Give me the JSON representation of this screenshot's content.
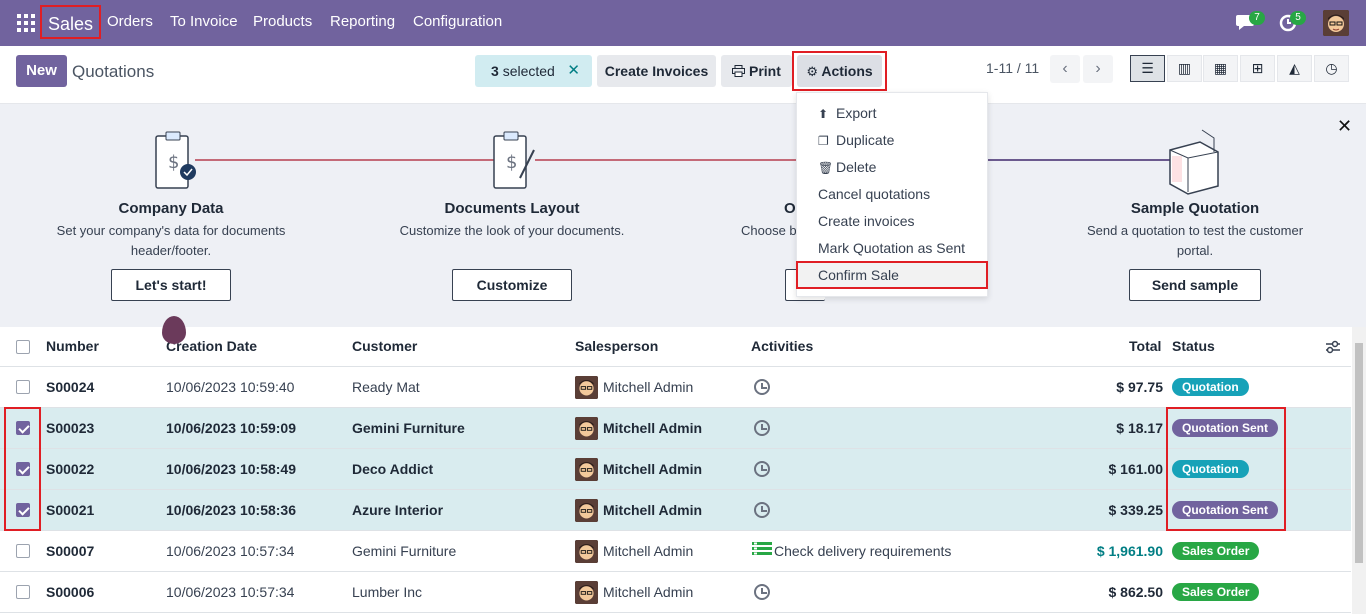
{
  "nav": {
    "brand": "Sales",
    "menu": [
      "Orders",
      "To Invoice",
      "Products",
      "Reporting",
      "Configuration"
    ],
    "messages_count": "7",
    "activities_count": "5"
  },
  "control_panel": {
    "new_label": "New",
    "title": "Quotations",
    "selected_count": "3",
    "selected_label": "selected",
    "create_invoices_label": "Create Invoices",
    "print_label": "Print",
    "actions_label": "Actions",
    "pager": "1-11 / 11"
  },
  "actions_menu": [
    {
      "label": "Export",
      "icon": "upload-icon"
    },
    {
      "label": "Duplicate",
      "icon": "copy-icon"
    },
    {
      "label": "Delete",
      "icon": "trash-icon"
    },
    {
      "label": "Cancel quotations",
      "icon": ""
    },
    {
      "label": "Create invoices",
      "icon": ""
    },
    {
      "label": "Mark Quotation as Sent",
      "icon": ""
    },
    {
      "label": "Confirm Sale",
      "icon": ""
    }
  ],
  "onboarding": {
    "steps": [
      {
        "title": "Company Data",
        "desc1": "Set your company's data for documents",
        "desc2": "header/footer.",
        "button": "Let's start!"
      },
      {
        "title": "Documents Layout",
        "desc1": "Customize the look of your documents.",
        "desc2": "",
        "button": "Customize"
      },
      {
        "title": "O",
        "desc1": "Choose b",
        "desc2": "",
        "button": ""
      },
      {
        "title": "Sample Quotation",
        "desc1": "Send a quotation to test the customer",
        "desc2": "portal.",
        "button": "Send sample"
      }
    ]
  },
  "table": {
    "headers": {
      "number": "Number",
      "creation_date": "Creation Date",
      "customer": "Customer",
      "salesperson": "Salesperson",
      "activities": "Activities",
      "total": "Total",
      "status": "Status"
    },
    "rows": [
      {
        "number": "S00024",
        "date": "10/06/2023 10:59:40",
        "customer": "Ready Mat",
        "salesperson": "Mitchell Admin",
        "activity": "",
        "total": "$ 97.75",
        "status": "Quotation",
        "selected": false
      },
      {
        "number": "S00023",
        "date": "10/06/2023 10:59:09",
        "customer": "Gemini Furniture",
        "salesperson": "Mitchell Admin",
        "activity": "",
        "total": "$ 18.17",
        "status": "Quotation Sent",
        "selected": true
      },
      {
        "number": "S00022",
        "date": "10/06/2023 10:58:49",
        "customer": "Deco Addict",
        "salesperson": "Mitchell Admin",
        "activity": "",
        "total": "$ 161.00",
        "status": "Quotation",
        "selected": true
      },
      {
        "number": "S00021",
        "date": "10/06/2023 10:58:36",
        "customer": "Azure Interior",
        "salesperson": "Mitchell Admin",
        "activity": "",
        "total": "$ 339.25",
        "status": "Quotation Sent",
        "selected": true
      },
      {
        "number": "S00007",
        "date": "10/06/2023 10:57:34",
        "customer": "Gemini Furniture",
        "salesperson": "Mitchell Admin",
        "activity": "Check delivery requirements",
        "total": "$ 1,961.90",
        "status": "Sales Order",
        "selected": false
      },
      {
        "number": "S00006",
        "date": "10/06/2023 10:57:34",
        "customer": "Lumber Inc",
        "salesperson": "Mitchell Admin",
        "activity": "",
        "total": "$ 862.50",
        "status": "Sales Order",
        "selected": false
      }
    ]
  },
  "colors": {
    "brand": "#71639e",
    "quotation": "#17a2b8",
    "quotation_sent": "#71639e",
    "sales_order": "#28a745",
    "highlight": "#e01e24"
  }
}
